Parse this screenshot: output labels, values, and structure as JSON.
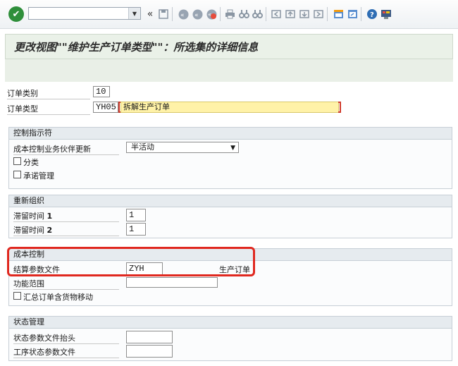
{
  "toolbar": {
    "command_field_value": "",
    "icons": [
      "check-icon",
      "back-icon",
      "save-icon",
      "back-nav-icon",
      "exit-icon",
      "cancel-icon",
      "print-icon",
      "find-icon",
      "find-next-icon",
      "first-page-icon",
      "prev-page-icon",
      "next-page-icon",
      "last-page-icon",
      "create-session-icon",
      "shortcut-icon",
      "help-icon",
      "customize-layout-icon"
    ],
    "back_glyph": "«"
  },
  "title": "更改视图\"\"维护生产订单类型\"\"：所选集的详细信息",
  "order_category": {
    "label": "订单类别",
    "value": "10"
  },
  "order_type": {
    "label": "订单类型",
    "value": "YH05",
    "description": "拆解生产订单"
  },
  "control_indicators": {
    "header": "控制指示符",
    "co_partner_update": {
      "label": "成本控制业务伙伴更新",
      "value": "半活动"
    },
    "classification": {
      "label": "分类",
      "checked": false
    },
    "commitments": {
      "label": "承诺管理",
      "checked": false
    }
  },
  "reorganization": {
    "header": "重新组织",
    "residence_time_1": {
      "label": "滞留时间",
      "num": "1",
      "value": "1"
    },
    "residence_time_2": {
      "label": "滞留时间",
      "num": "2",
      "value": "1"
    }
  },
  "cost_control": {
    "header": "成本控制",
    "settlement_profile": {
      "label": "结算参数文件",
      "value": "ZYH",
      "description": "生产订单"
    },
    "functional_area": {
      "label": "功能范围",
      "value": ""
    },
    "summarize_goods_movements": {
      "label": "汇总订单含货物移动",
      "checked": false
    }
  },
  "status_management": {
    "header": "状态管理",
    "status_profile_header": {
      "label": "状态参数文件抬头",
      "value": ""
    },
    "operation_status_profile": {
      "label": "工序状态参数文件",
      "value": ""
    }
  },
  "colors": {
    "highlight": "#e0281f",
    "title_bg": "#eaf1e8",
    "yellow_field": "#fff2a8"
  }
}
